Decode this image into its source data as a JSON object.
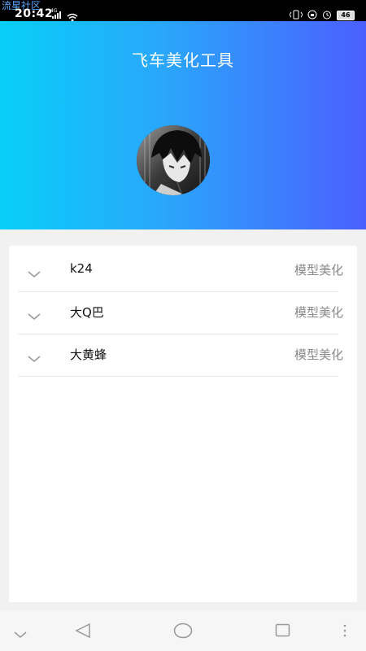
{
  "watermark": "流星社区",
  "status": {
    "time": "20:42",
    "network": "4G",
    "battery": "46"
  },
  "header": {
    "title": "飞车美化工具"
  },
  "list": [
    {
      "name": "k24",
      "tag": "模型美化"
    },
    {
      "name": "大Q巴",
      "tag": "模型美化"
    },
    {
      "name": "大黄蜂",
      "tag": "模型美化"
    }
  ],
  "colors": {
    "gradient_start": "#08cff8",
    "gradient_end": "#4b5ffe"
  },
  "icons": {
    "row": "chevron-down-icon",
    "nav": [
      "hide-nav-icon",
      "back-icon",
      "home-icon",
      "recents-icon",
      "more-icon"
    ]
  }
}
